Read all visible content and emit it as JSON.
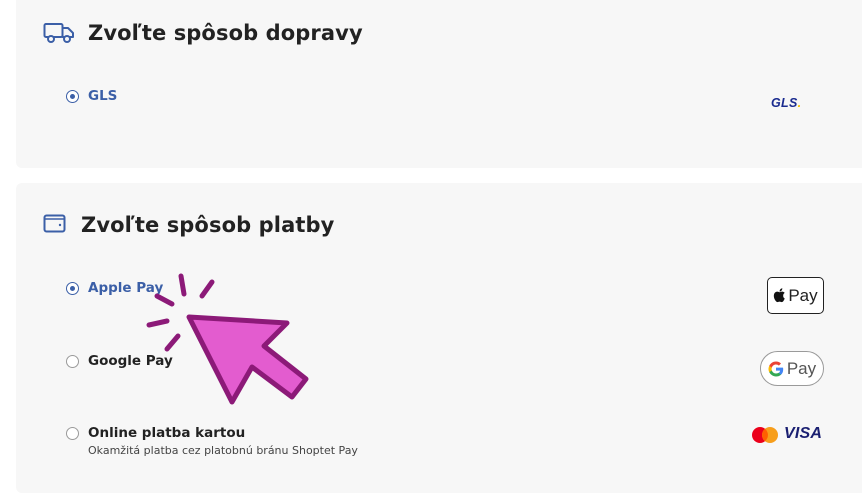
{
  "shipping": {
    "title": "Zvoľte spôsob dopravy",
    "icon": "truck-icon",
    "options": [
      {
        "label": "GLS",
        "selected": true,
        "logo_text": "GLS",
        "logo_dot": "."
      }
    ]
  },
  "payment": {
    "title": "Zvoľte spôsob platby",
    "icon": "wallet-icon",
    "options": [
      {
        "label": "Apple Pay",
        "selected": true,
        "badge_text": "Pay",
        "badge_icon": "apple-icon"
      },
      {
        "label": "Google Pay",
        "selected": false,
        "badge_text": "Pay",
        "badge_icon": "google-g-icon"
      },
      {
        "label": "Online platba kartou",
        "selected": false,
        "description": "Okamžitá platba cez platobnú bránu Shoptet Pay",
        "logo_text": "VISA",
        "logo_icon": "mastercard-icon"
      }
    ]
  },
  "colors": {
    "accent": "#3b5fa7",
    "panel_bg": "#f7f7f7",
    "pointer_fill": "#e35ccf",
    "pointer_stroke": "#8c1a78"
  },
  "overlay": {
    "icon": "pointer-arrow-icon"
  }
}
